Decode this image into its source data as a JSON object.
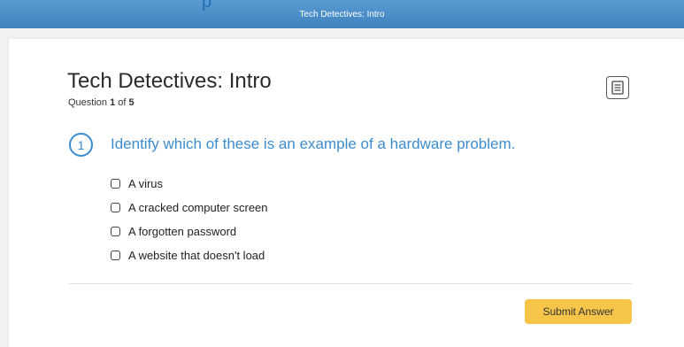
{
  "header": {
    "title": "Tech Detectives: Intro",
    "color": "#4a8fcb"
  },
  "quiz": {
    "title": "Tech Detectives: Intro",
    "question_prefix": "Question ",
    "current": "1",
    "of_text": " of ",
    "total": "5"
  },
  "question": {
    "number": "1",
    "text": "Identify which of these is an example of a hardware problem.",
    "color": "#3d8ccd"
  },
  "choices": [
    {
      "label": "A virus",
      "checked": false
    },
    {
      "label": "A cracked computer screen",
      "checked": false
    },
    {
      "label": "A forgotten password",
      "checked": false
    },
    {
      "label": "A website that doesn't load",
      "checked": false
    }
  ],
  "actions": {
    "submit_label": "Submit Answer",
    "submit_color": "#f6c54a"
  },
  "icons": {
    "notes": "notes-icon"
  }
}
